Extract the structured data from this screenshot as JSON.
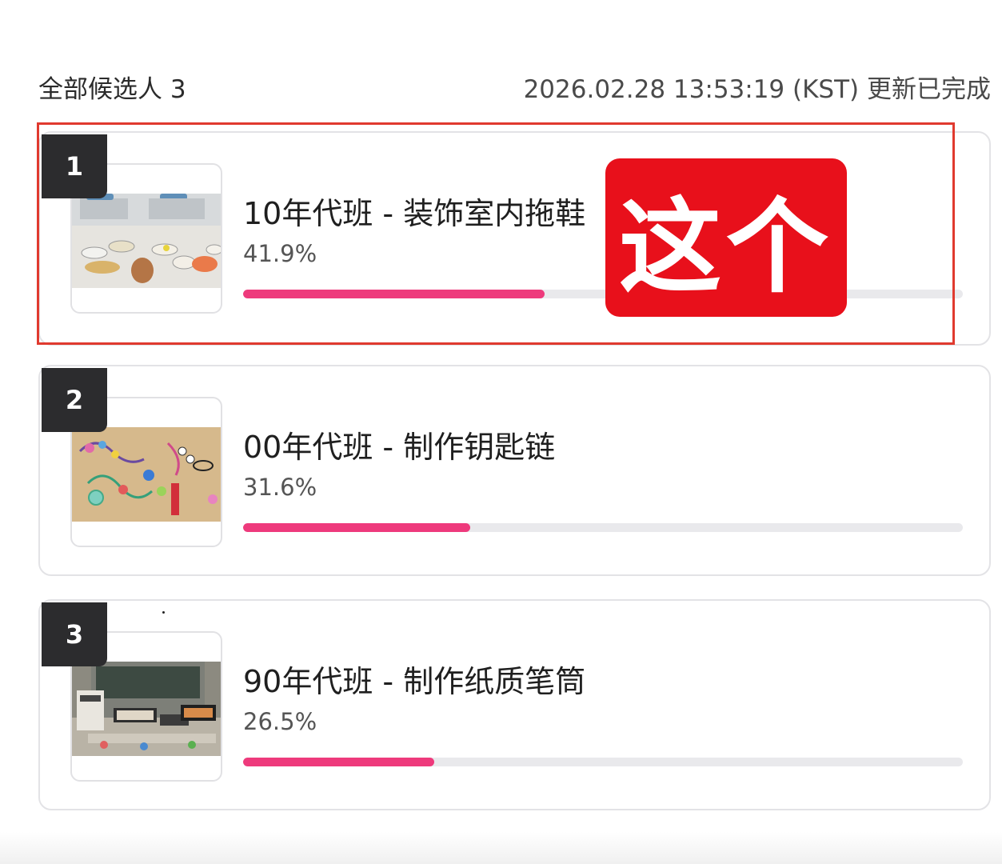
{
  "header": {
    "total_label": "全部候选人 3",
    "updated_text": "2026.02.28 13:53:19 (KST) 更新已完成"
  },
  "candidates": [
    {
      "rank": "1",
      "title": "10年代班 - 装饰室内拖鞋",
      "percent_text": "41.9%",
      "progress": 0.419,
      "photo": "decorated-slippers-photo"
    },
    {
      "rank": "2",
      "title": "00年代班 - 制作钥匙链",
      "percent_text": "31.6%",
      "progress": 0.316,
      "photo": "keychains-photo"
    },
    {
      "rank": "3",
      "title": "90年代班 - 制作纸质笔筒",
      "percent_text": "26.5%",
      "progress": 0.265,
      "photo": "paper-pen-holders-photo"
    }
  ],
  "annotation": {
    "stamp_text": "这个"
  },
  "colors": {
    "progress_fill": "#ee3a7c",
    "progress_track": "#e9e9ec",
    "rank_badge": "#2c2c2e",
    "highlight_border": "#e03a2f",
    "stamp_bg": "#e8101b"
  }
}
